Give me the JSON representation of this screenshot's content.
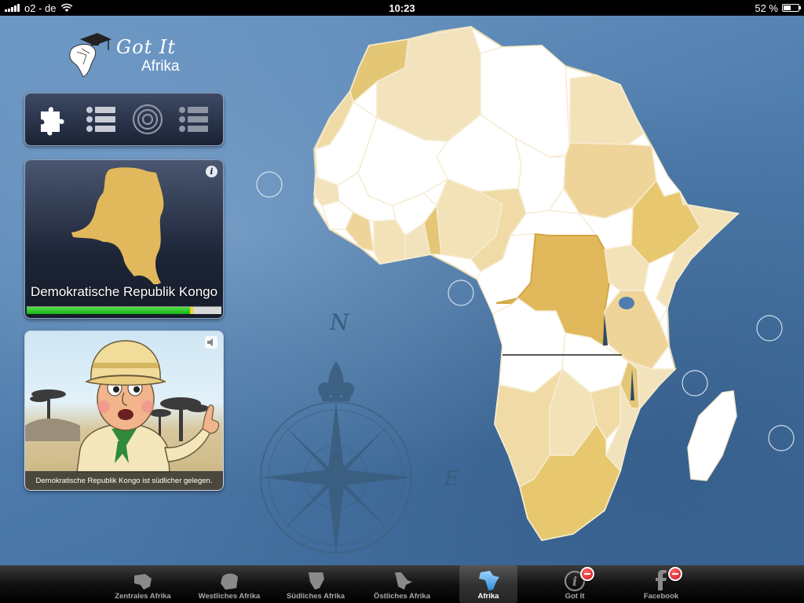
{
  "status_bar": {
    "carrier": "o2 - de",
    "time": "10:23",
    "battery": "52 %",
    "battery_level": 0.52
  },
  "logo": {
    "line1": "Got It",
    "line2": "Afrika"
  },
  "modes": {
    "items": [
      {
        "name": "puzzle-mode",
        "icon": "puzzle-icon",
        "active": true
      },
      {
        "name": "list-mode",
        "icon": "list-icon",
        "active": false
      },
      {
        "name": "target-mode",
        "icon": "target-icon",
        "active": false
      },
      {
        "name": "list-mode-2",
        "icon": "list-icon",
        "active": false
      }
    ]
  },
  "country_card": {
    "country_name": "Demokratische Republik Kongo",
    "progress": 0.84,
    "info_icon": "info-icon"
  },
  "explorer": {
    "caption": "Demokratische Republik Kongo ist südlicher gelegen.",
    "speaker_icon": "speaker-icon"
  },
  "compass": {
    "north": "N",
    "east": "E"
  },
  "colors": {
    "highlight": "#e1b85b",
    "light_tan": "#f3e2b8",
    "mid_tan": "#ead191",
    "unassigned": "#ffffff",
    "progress": "#22c11f",
    "ocean": "#4f7dad"
  },
  "tabbar": {
    "tabs": [
      {
        "label": "Zentrales Afrika",
        "icon": "central-africa-icon",
        "active": false,
        "badge": false
      },
      {
        "label": "Westliches Afrika",
        "icon": "west-africa-icon",
        "active": false,
        "badge": false
      },
      {
        "label": "Südliches Afrika",
        "icon": "southern-africa-icon",
        "active": false,
        "badge": false
      },
      {
        "label": "Östliches Afrika",
        "icon": "east-africa-icon",
        "active": false,
        "badge": false
      },
      {
        "label": "Afrika",
        "icon": "africa-icon",
        "active": true,
        "badge": false
      },
      {
        "label": "Got It",
        "icon": "info-icon",
        "active": false,
        "badge": true
      },
      {
        "label": "Facebook",
        "icon": "facebook-icon",
        "active": false,
        "badge": true
      }
    ]
  }
}
